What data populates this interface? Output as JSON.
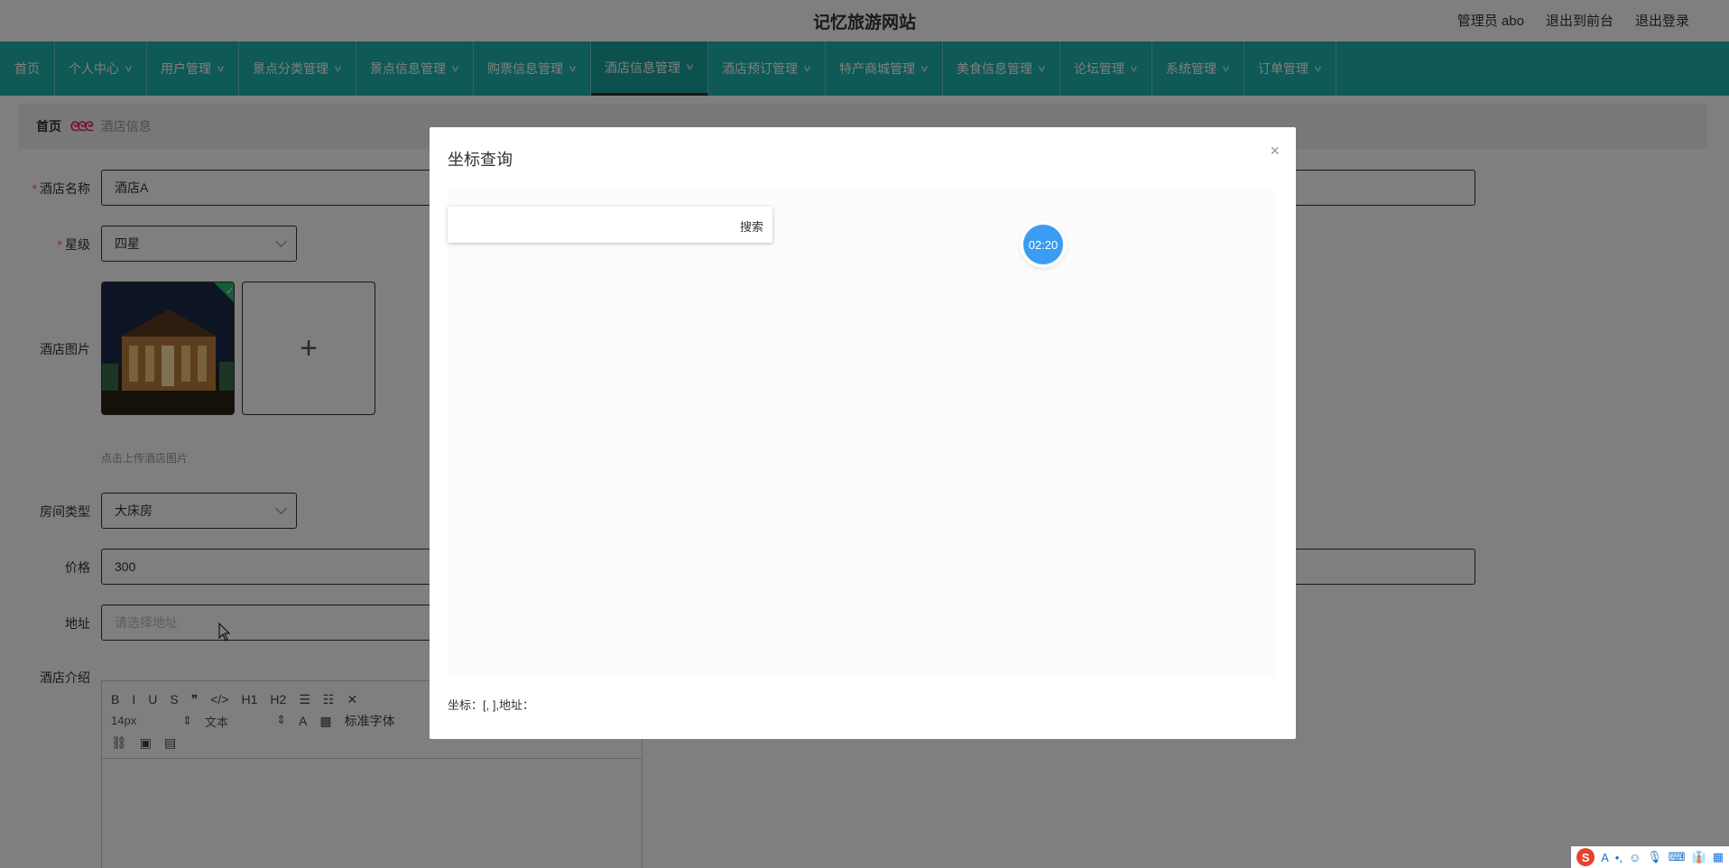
{
  "header": {
    "site_title": "记忆旅游网站",
    "admin_label": "管理员 abo",
    "to_front": "退出到前台",
    "logout": "退出登录"
  },
  "nav": {
    "items": [
      {
        "label": "首页"
      },
      {
        "label": "个人中心"
      },
      {
        "label": "用户管理"
      },
      {
        "label": "景点分类管理"
      },
      {
        "label": "景点信息管理"
      },
      {
        "label": "购票信息管理"
      },
      {
        "label": "酒店信息管理"
      },
      {
        "label": "酒店预订管理"
      },
      {
        "label": "特产商城管理"
      },
      {
        "label": "美食信息管理"
      },
      {
        "label": "论坛管理"
      },
      {
        "label": "系统管理"
      },
      {
        "label": "订单管理"
      }
    ],
    "active_index": 6
  },
  "breadcrumb": {
    "home": "首页",
    "separator": "ᘓᘓᘓ",
    "current": "酒店信息"
  },
  "form": {
    "name_label": "酒店名称",
    "name_value": "酒店A",
    "star_label": "星级",
    "star_value": "四星",
    "image_label": "酒店图片",
    "upload_plus": "+",
    "upload_hint": "点击上传酒店图片",
    "room_label": "房间类型",
    "room_value": "大床房",
    "price_label": "价格",
    "price_value": "300",
    "address_label": "地址",
    "address_placeholder": "请选择地址",
    "intro_label": "酒店介绍"
  },
  "editor": {
    "row1": [
      "B",
      "I",
      "U",
      "S",
      "❞",
      "</>",
      "H1",
      "H2",
      "☰",
      "☷",
      "✕"
    ],
    "font_size": "14px",
    "font_type": "文本",
    "font_family": "标准字体",
    "row3": [
      "link-icon",
      "image-icon",
      "video-icon"
    ]
  },
  "dialog": {
    "title": "坐标查询",
    "close": "×",
    "search_button": "搜索",
    "coord_text": "坐标：[, ],地址："
  },
  "timer": {
    "text": "02:20"
  },
  "ime": {
    "logo": "S",
    "items": [
      "A",
      "•,",
      "☺",
      "🎙",
      "⌨",
      "👔",
      "▦"
    ]
  }
}
